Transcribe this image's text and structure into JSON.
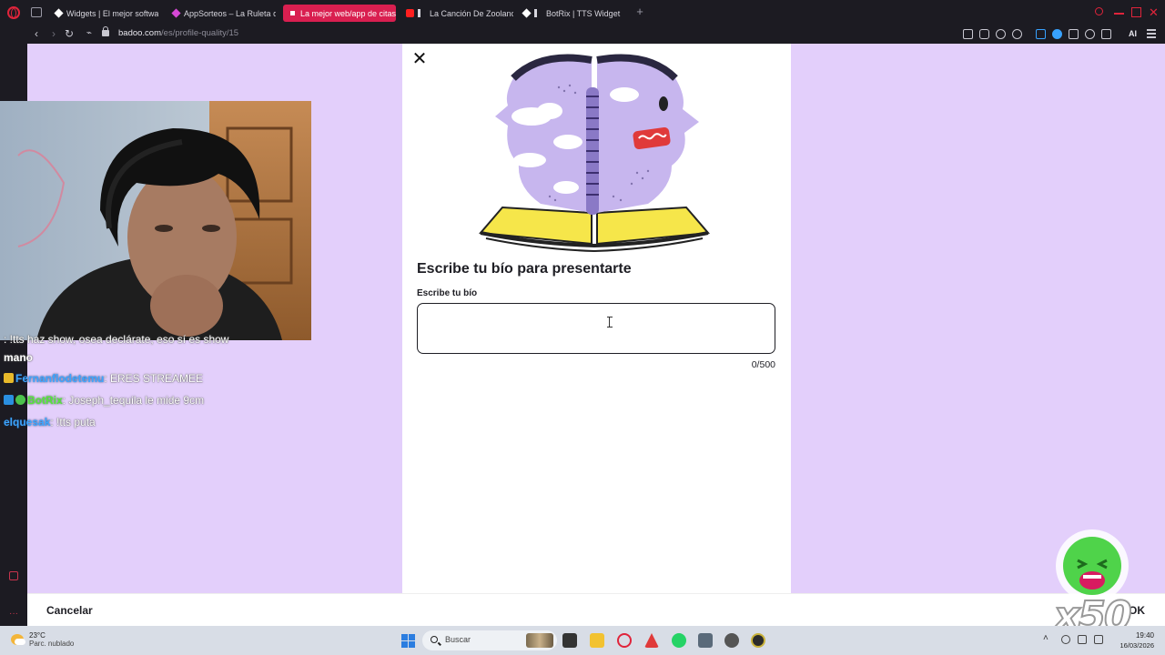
{
  "browser": {
    "tabs": [
      {
        "label": "Widgets | El mejor softwa",
        "icon": "widgets-favicon-icon",
        "active": false
      },
      {
        "label": "AppSorteos – La Ruleta de",
        "icon": "appsorteos-favicon-icon",
        "active": false
      },
      {
        "label": "La mejor web/app de citas",
        "icon": "badoo-favicon-icon",
        "active": true
      },
      {
        "label": "La Canción De Zoolanc",
        "icon": "youtube-favicon-icon",
        "active": false
      },
      {
        "label": "BotRix | TTS Widget",
        "icon": "botrix-favicon-icon",
        "active": false
      }
    ],
    "url_host": "badoo.com",
    "url_path": "/es/profile-quality/15",
    "ai_label": "AI"
  },
  "modal": {
    "title": "Escribe tu bío para presentarte",
    "field_label": "Escribe tu bío",
    "field_value": "",
    "counter": "0/500"
  },
  "footer": {
    "cancel_label": "Cancelar",
    "ok_label": "OK"
  },
  "chat": {
    "messages": [
      {
        "user": "",
        "text": ": !tts haz show, osea declárate, eso sí es show"
      },
      {
        "user": "",
        "text": "mano"
      },
      {
        "user": "Fernanflodetemu",
        "text": ": ERES STREAMEE"
      },
      {
        "user": "BotRix",
        "text": ": Joseph_tequila le mide 9cm"
      },
      {
        "user": "elquesak",
        "text": ": !tts puta"
      }
    ]
  },
  "sticker": {
    "label": "x50"
  },
  "taskbar": {
    "weather_temp": "23°C",
    "weather_desc": "Parc. nublado",
    "search_placeholder": "Buscar",
    "time": "19:40",
    "date": "16/03/2026"
  },
  "colors": {
    "page_bg": "#e3cffb",
    "modal_bg": "#ffffff",
    "active_tab": "#d91f50",
    "chrome_bg": "#1c1b22",
    "chat_user": "#3da5ff",
    "chat_bot": "#58e63d"
  }
}
